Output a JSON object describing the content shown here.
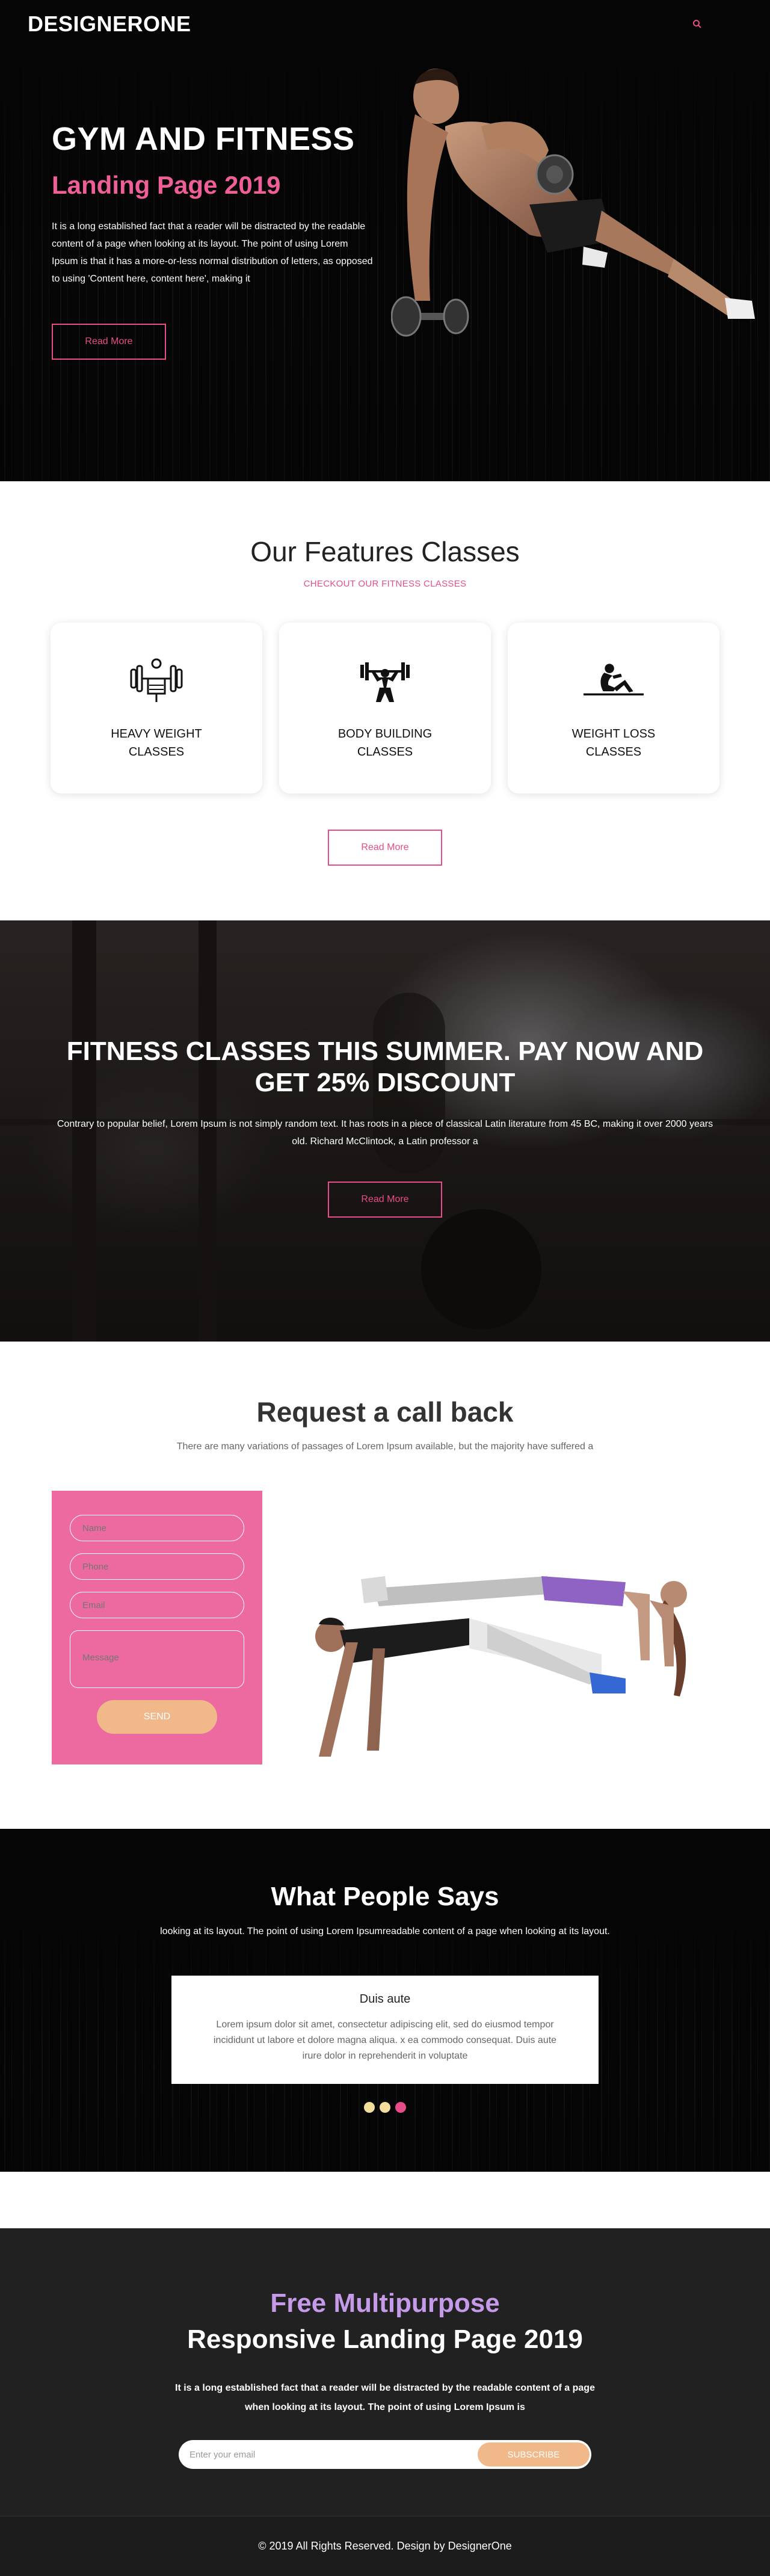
{
  "nav": {
    "logo": "DESIGNERONE",
    "search_icon": "search-icon",
    "accent": "#e64d8a"
  },
  "hero": {
    "title": "GYM AND FITNESS",
    "subtitle": "Landing Page 2019",
    "paragraph": "It is a long established fact that a reader will be distracted by the readable content of a page when looking at its layout. The point of using Lorem Ipsum is that it has a more-or-less normal distribution of letters, as opposed to using 'Content here, content here', making it",
    "button_label": "Read More"
  },
  "features": {
    "title": "Our Features Classes",
    "kicker": "CHECKOUT OUR FITNESS CLASSES",
    "cards": [
      {
        "icon": "weightlifter-icon",
        "label": "HEAVY WEIGHT CLASSES"
      },
      {
        "icon": "bodybuilder-icon",
        "label": "BODY BUILDING CLASSES"
      },
      {
        "icon": "situp-icon",
        "label": "WEIGHT LOSS CLASSES"
      }
    ],
    "button_label": "Read More"
  },
  "promo": {
    "title": "FITNESS CLASSES THIS SUMMER. PAY NOW AND GET 25% DISCOUNT",
    "paragraph": "Contrary to popular belief, Lorem Ipsum is not simply random text. It has roots in a piece of classical Latin literature from 45 BC, making it over 2000 years old. Richard McClintock, a Latin professor a",
    "button_label": "Read More"
  },
  "callback": {
    "title": "Request a call back",
    "subtitle": "There are many variations of passages of Lorem Ipsum available, but the majority have suffered a",
    "form": {
      "name_placeholder": "Name",
      "phone_placeholder": "Phone",
      "email_placeholder": "Email",
      "message_placeholder": "Message",
      "send_label": "SEND"
    },
    "form_color": "#ec6aa0"
  },
  "testimonials": {
    "title": "What People Says",
    "subtitle": "looking at its layout. The point of using Lorem Ipsumreadable content of a page when looking at its layout.",
    "card": {
      "name": "Duis aute",
      "quote": "Lorem ipsum dolor sit amet, consectetur adipiscing elit, sed do eiusmod tempor incididunt ut labore et dolore magna aliqua. x ea commodo consequat. Duis aute irure dolor in reprehenderit in voluptate"
    },
    "dot_colors": [
      "#f3dd9a",
      "#f3dd9a",
      "#e64d8a"
    ]
  },
  "newsletter": {
    "kicker": "Free Multipurpose",
    "title": "Responsive Landing Page 2019",
    "paragraph": "It is a long established fact that a reader will be distracted by the readable content of a page when looking at its layout. The point of using Lorem Ipsum is",
    "email_placeholder": "Enter your email",
    "subscribe_label": "SUBSCRIBE"
  },
  "footer": {
    "copyright": "© 2019 All Rights Reserved. Design by DesignerOne"
  }
}
